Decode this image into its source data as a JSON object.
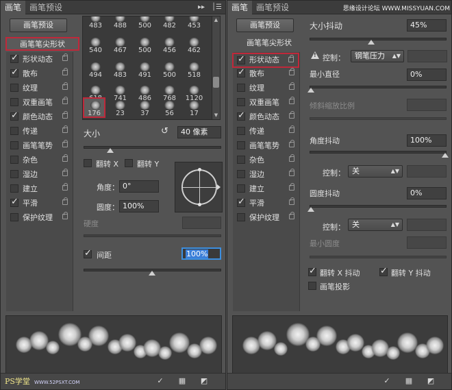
{
  "left": {
    "tabs": [
      "画笔",
      "画笔预设"
    ],
    "preset_button": "画笔预设",
    "tip_shape_header": "画笔笔尖形状",
    "categories": [
      {
        "label": "形状动态",
        "checked": true
      },
      {
        "label": "散布",
        "checked": true
      },
      {
        "label": "纹理",
        "checked": false
      },
      {
        "label": "双重画笔",
        "checked": false
      },
      {
        "label": "颜色动态",
        "checked": true
      },
      {
        "label": "传递",
        "checked": false
      },
      {
        "label": "画笔笔势",
        "checked": false
      },
      {
        "label": "杂色",
        "checked": false
      },
      {
        "label": "湿边",
        "checked": false
      },
      {
        "label": "建立",
        "checked": false
      },
      {
        "label": "平滑",
        "checked": true
      },
      {
        "label": "保护纹理",
        "checked": false
      }
    ],
    "brushes": [
      [
        "483",
        "488",
        "500",
        "482",
        "453"
      ],
      [
        "540",
        "467",
        "500",
        "456",
        "462"
      ],
      [
        "494",
        "483",
        "491",
        "500",
        "518"
      ],
      [
        "618",
        "741",
        "486",
        "768",
        "1120"
      ],
      [
        "176",
        "23",
        "37",
        "56",
        "17"
      ]
    ],
    "size_label": "大小",
    "size_value": "40 像素",
    "flip_x": "翻转 X",
    "flip_y": "翻转 Y",
    "angle_label": "角度：",
    "angle_value": "0°",
    "roundness_label": "圆度：",
    "roundness_value": "100%",
    "hardness_label": "硬度",
    "spacing_label": "间距",
    "spacing_value": "100%",
    "logo_text": "PS学堂",
    "logo_url": "WWW.52PSXT.COM"
  },
  "right": {
    "tabs": [
      "画笔",
      "画笔预设"
    ],
    "watermark": "思缘设计论坛 WWW.MISSYUAN.COM",
    "preset_button": "画笔预设",
    "tip_shape_header": "画笔笔尖形状",
    "categories": [
      {
        "label": "形状动态",
        "checked": true
      },
      {
        "label": "散布",
        "checked": true
      },
      {
        "label": "纹理",
        "checked": false
      },
      {
        "label": "双重画笔",
        "checked": false
      },
      {
        "label": "颜色动态",
        "checked": true
      },
      {
        "label": "传递",
        "checked": false
      },
      {
        "label": "画笔笔势",
        "checked": false
      },
      {
        "label": "杂色",
        "checked": false
      },
      {
        "label": "湿边",
        "checked": false
      },
      {
        "label": "建立",
        "checked": false
      },
      {
        "label": "平滑",
        "checked": true
      },
      {
        "label": "保护纹理",
        "checked": false
      }
    ],
    "size_jitter_label": "大小抖动",
    "size_jitter_value": "45%",
    "control_label": "控制：",
    "control_pen": "钢笔压力",
    "min_diameter_label": "最小直径",
    "min_diameter_value": "0%",
    "tilt_scale_label": "倾斜缩放比例",
    "angle_jitter_label": "角度抖动",
    "angle_jitter_value": "100%",
    "control_off_1": "关",
    "roundness_jitter_label": "圆度抖动",
    "roundness_jitter_value": "0%",
    "control_off_2": "关",
    "min_roundness_label": "最小圆度",
    "flip_x_jitter": "翻转 X 抖动",
    "flip_y_jitter": "翻转 Y 抖动",
    "brush_projection": "画笔投影"
  }
}
